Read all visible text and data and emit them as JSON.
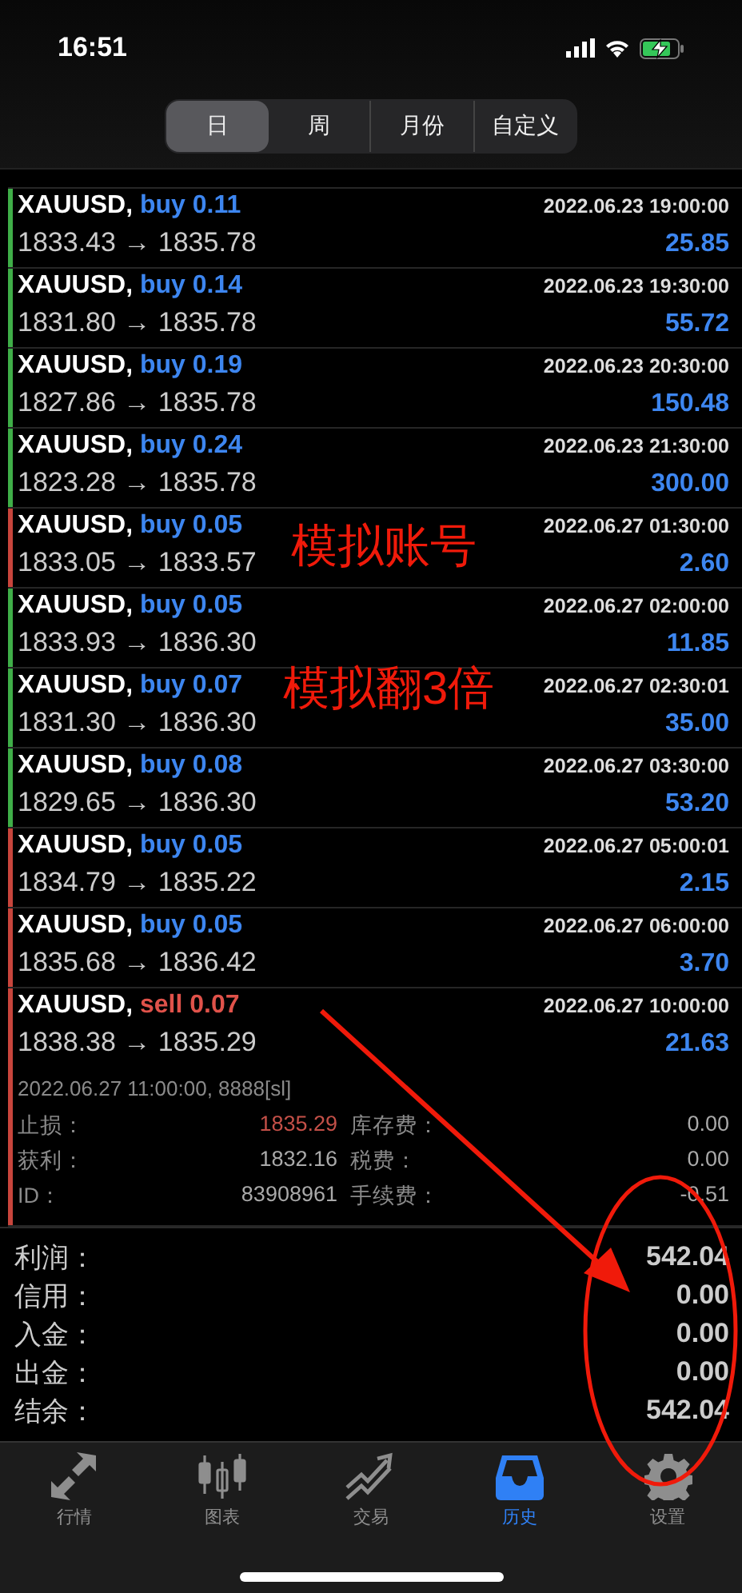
{
  "status_bar": {
    "time": "16:51"
  },
  "period_tabs": [
    {
      "label": "日",
      "selected": true
    },
    {
      "label": "周",
      "selected": false
    },
    {
      "label": "月份",
      "selected": false
    },
    {
      "label": "自定义",
      "selected": false
    }
  ],
  "deals": [
    {
      "symbol": "XAUUSD,",
      "kind": "buy",
      "order": "buy 0.11",
      "prices": "1833.43 → 1835.78",
      "time": "2022.06.23 19:00:00",
      "profit": "25.85",
      "color": "#3fae48"
    },
    {
      "symbol": "XAUUSD,",
      "kind": "buy",
      "order": "buy 0.14",
      "prices": "1831.80 → 1835.78",
      "time": "2022.06.23 19:30:00",
      "profit": "55.72",
      "color": "#3fae48"
    },
    {
      "symbol": "XAUUSD,",
      "kind": "buy",
      "order": "buy 0.19",
      "prices": "1827.86 → 1835.78",
      "time": "2022.06.23 20:30:00",
      "profit": "150.48",
      "color": "#3fae48"
    },
    {
      "symbol": "XAUUSD,",
      "kind": "buy",
      "order": "buy 0.24",
      "prices": "1823.28 → 1835.78",
      "time": "2022.06.23 21:30:00",
      "profit": "300.00",
      "color": "#3fae48"
    },
    {
      "symbol": "XAUUSD,",
      "kind": "buy",
      "order": "buy 0.05",
      "prices": "1833.05 → 1833.57",
      "time": "2022.06.27 01:30:00",
      "profit": "2.60",
      "color": "#c8453c"
    },
    {
      "symbol": "XAUUSD,",
      "kind": "buy",
      "order": "buy 0.05",
      "prices": "1833.93 → 1836.30",
      "time": "2022.06.27 02:00:00",
      "profit": "11.85",
      "color": "#3fae48"
    },
    {
      "symbol": "XAUUSD,",
      "kind": "buy",
      "order": "buy 0.07",
      "prices": "1831.30 → 1836.30",
      "time": "2022.06.27 02:30:01",
      "profit": "35.00",
      "color": "#3fae48"
    },
    {
      "symbol": "XAUUSD,",
      "kind": "buy",
      "order": "buy 0.08",
      "prices": "1829.65 → 1836.30",
      "time": "2022.06.27 03:30:00",
      "profit": "53.20",
      "color": "#3fae48"
    },
    {
      "symbol": "XAUUSD,",
      "kind": "buy",
      "order": "buy 0.05",
      "prices": "1834.79 → 1835.22",
      "time": "2022.06.27 05:00:01",
      "profit": "2.15",
      "color": "#c8453c"
    },
    {
      "symbol": "XAUUSD,",
      "kind": "buy",
      "order": "buy 0.05",
      "prices": "1835.68 → 1836.42",
      "time": "2022.06.27 06:00:00",
      "profit": "3.70",
      "color": "#c8453c"
    },
    {
      "symbol": "XAUUSD,",
      "kind": "sell",
      "order": "sell 0.07",
      "prices": "1838.38 → 1835.29",
      "time": "2022.06.27 10:00:00",
      "profit": "21.63",
      "color": "#c8453c",
      "details": {
        "close": "2022.06.27 11:00:00, 8888[sl]",
        "fields": [
          {
            "label": "止损：",
            "value": "1835.29",
            "kind": "stop",
            "label2": "库存费：",
            "value2": "0.00"
          },
          {
            "label": "获利：",
            "value": "1832.16",
            "kind": "plain",
            "label2": "税费：",
            "value2": "0.00"
          },
          {
            "label": "ID：",
            "value": "83908961",
            "kind": "plain",
            "label2": "手续费：",
            "value2": "-0.51"
          }
        ]
      }
    }
  ],
  "summary": [
    {
      "label": "利润：",
      "value": "542.04"
    },
    {
      "label": "信用：",
      "value": "0.00"
    },
    {
      "label": "入金：",
      "value": "0.00"
    },
    {
      "label": "出金：",
      "value": "0.00"
    },
    {
      "label": "结余：",
      "value": "542.04"
    }
  ],
  "tab_bar": [
    {
      "label": "行情",
      "kind": "quotes",
      "selected": false
    },
    {
      "label": "图表",
      "kind": "chart",
      "selected": false
    },
    {
      "label": "交易",
      "kind": "trade",
      "selected": false
    },
    {
      "label": "历史",
      "kind": "history",
      "selected": true
    },
    {
      "label": "设置",
      "kind": "settings",
      "selected": false
    }
  ],
  "annotations": [
    {
      "text": "模拟账号"
    },
    {
      "text": "模拟翻3倍"
    }
  ]
}
